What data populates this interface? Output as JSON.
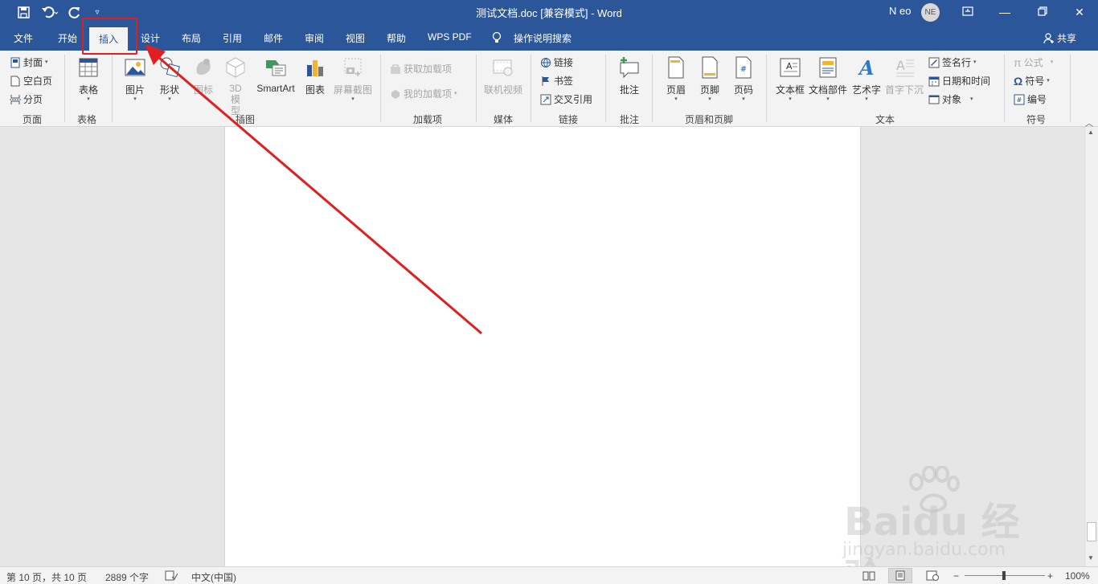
{
  "title_bar": {
    "title": "测试文档.doc [兼容模式]  -  Word",
    "user_name": "N eo",
    "avatar_initials": "NE",
    "color": "#2b579a"
  },
  "tabs": [
    "文件",
    "开始",
    "插入",
    "设计",
    "布局",
    "引用",
    "邮件",
    "审阅",
    "视图",
    "帮助",
    "WPS PDF"
  ],
  "active_tab": "插入",
  "tell_me": "操作说明搜索",
  "share": "共享",
  "ribbon": {
    "pages": {
      "cover": "封面",
      "blank": "空白页",
      "break": "分页",
      "label": "页面"
    },
    "tables": {
      "table": "表格",
      "label": "表格"
    },
    "illustrations": {
      "picture": "图片",
      "shapes": "形状",
      "icons": "图标",
      "model_3d": "3D 模型",
      "smartart": "SmartArt",
      "chart": "图表",
      "screenshot": "屏幕截图",
      "label": "插图"
    },
    "addins": {
      "get": "获取加载项",
      "mine": "我的加载项",
      "label": "加载项"
    },
    "media": {
      "online_video": "联机视频",
      "label": "媒体"
    },
    "links": {
      "link": "链接",
      "bookmark": "书签",
      "cross_ref": "交叉引用",
      "label": "链接"
    },
    "comments": {
      "comment": "批注",
      "label": "批注"
    },
    "header_footer": {
      "header": "页眉",
      "footer": "页脚",
      "page_number": "页码",
      "label": "页眉和页脚"
    },
    "text": {
      "textbox": "文本框",
      "quick_parts": "文档部件",
      "wordart": "艺术字",
      "dropcap": "首字下沉",
      "signature": "签名行",
      "datetime": "日期和时间",
      "object": "对象",
      "label": "文本"
    },
    "symbols": {
      "equation": "公式",
      "symbol": "符号",
      "number": "编号",
      "label": "符号"
    }
  },
  "status_bar": {
    "page": "第 10 页，共 10 页",
    "words": "2889 个字",
    "language": "中文(中国)",
    "zoom": "100%",
    "zoom_minus": "−",
    "zoom_plus": "+"
  },
  "watermark": {
    "logo": "Baidu 经验",
    "url": "jingyan.baidu.com"
  },
  "annotation_color": "#e02020"
}
